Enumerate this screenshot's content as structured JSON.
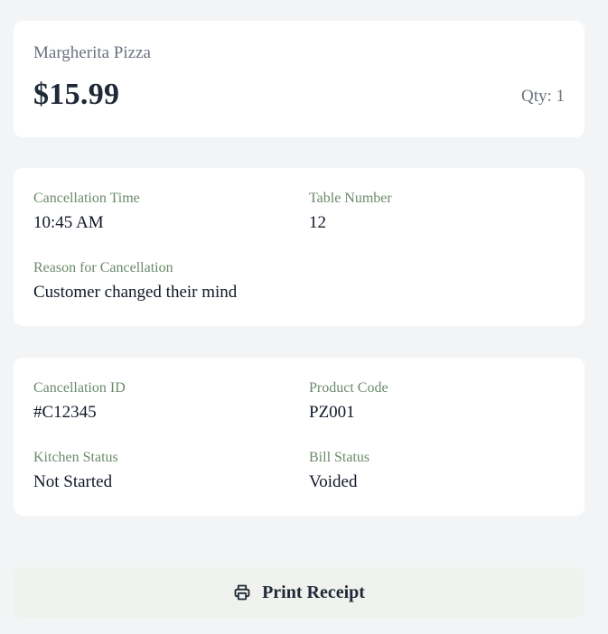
{
  "item": {
    "name": "Margherita Pizza",
    "price": "$15.99",
    "quantity": "Qty: 1"
  },
  "cancellation": {
    "time_label": "Cancellation Time",
    "time_value": "10:45 AM",
    "table_label": "Table Number",
    "table_value": "12",
    "reason_label": "Reason for Cancellation",
    "reason_value": "Customer changed their mind"
  },
  "meta": {
    "id_label": "Cancellation ID",
    "id_value": "#C12345",
    "product_code_label": "Product Code",
    "product_code_value": "PZ001",
    "kitchen_status_label": "Kitchen Status",
    "kitchen_status_value": "Not Started",
    "bill_status_label": "Bill Status",
    "bill_status_value": "Voided"
  },
  "actions": {
    "print_label": "Print Receipt",
    "print_icon": "printer-icon"
  },
  "colors": {
    "background": "#f3f4f6",
    "card": "#ffffff",
    "label_green": "#6b8a6b",
    "button_bg": "#f0f2ed"
  }
}
